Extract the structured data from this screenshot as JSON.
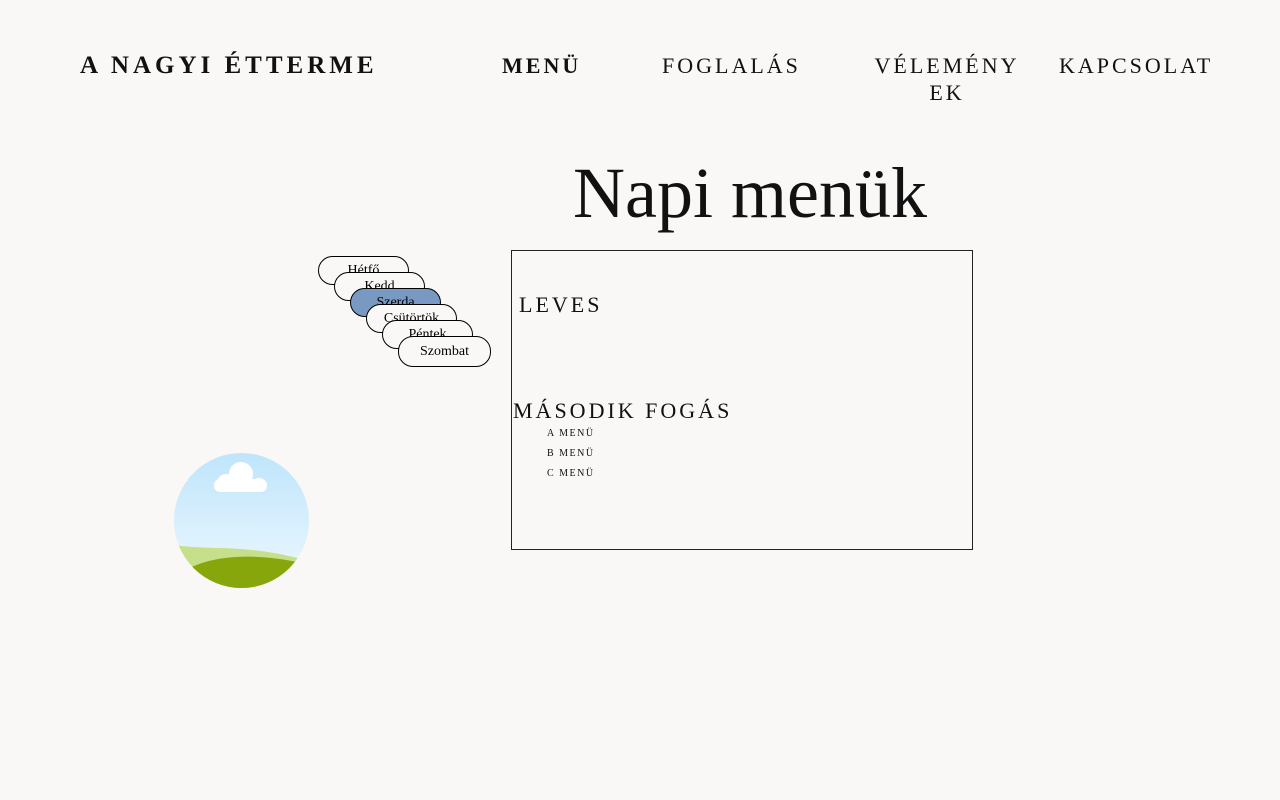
{
  "header": {
    "brand": "A NAGYI ÉTTERME",
    "nav": {
      "menu": "MENÜ",
      "foglalas": "FOGLALÁS",
      "velemenyek": "VÉLEMÉNYEK",
      "kapcsolat": "KAPCSOLAT"
    }
  },
  "main": {
    "title": "Napi menük",
    "days": [
      "Hétfő",
      "Kedd",
      "Szerda",
      "Csütörtök",
      "Péntek",
      "Szombat"
    ],
    "selected_day": "Szerda",
    "sections": {
      "soup": "LEVES",
      "main_course": "MÁSODIK FOGÁS",
      "options": [
        "A MENÜ",
        "B MENÜ",
        "C MENÜ"
      ]
    }
  },
  "colors": {
    "background": "#f9f8f6",
    "active_day": "#7899c1"
  },
  "icons": {
    "image_placeholder": "landscape-image-icon"
  }
}
